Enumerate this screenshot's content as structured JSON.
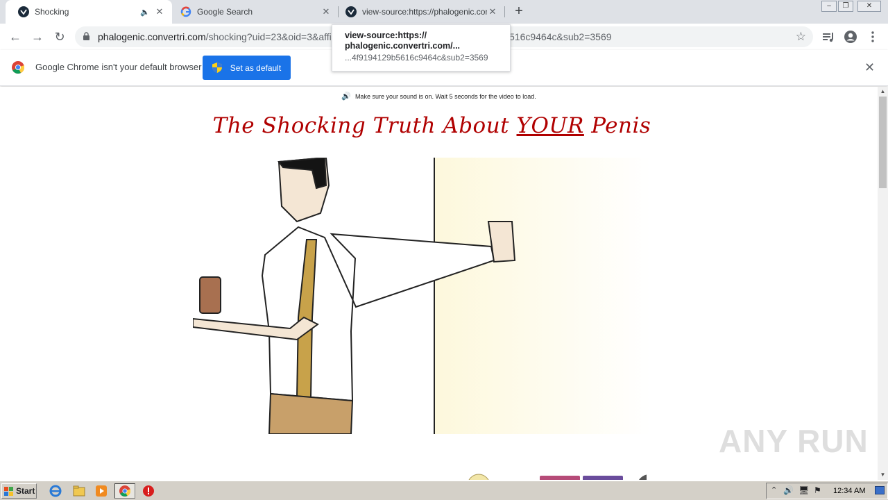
{
  "tabs": [
    {
      "title": "Shocking",
      "favicon": "convertri-icon",
      "audio": true,
      "active": true
    },
    {
      "title": "Google Search",
      "favicon": "google-g-icon",
      "active": false
    },
    {
      "title": "view-source:https://phalogenic.conv",
      "favicon": "convertri-icon",
      "active": false
    }
  ],
  "address_bar": {
    "host": "phalogenic.convertri.com",
    "path": "/shocking?uid=23&oid=3&affi",
    "tail": "516c9464c&sub2=3569"
  },
  "tooltip": {
    "line1": "view-source:https://",
    "line2": "phalogenic.convertri.com/...",
    "line3": "...4f9194129b5616c9464c&sub2=3569"
  },
  "infobar": {
    "message": "Google Chrome isn't your default browser",
    "button_label": "Set as default"
  },
  "page": {
    "sound_note": "Make sure your sound is on. Wait 5 seconds for the video to load.",
    "headline_pre": "The Shocking Truth About ",
    "headline_em": "YOUR",
    "headline_post": " Penis"
  },
  "watermark": "ANY RUN",
  "taskbar": {
    "start_label": "Start",
    "clock": "12:34 AM",
    "apps": [
      "ie-icon",
      "explorer-icon",
      "media-player-icon",
      "chrome-icon",
      "stop-icon"
    ]
  },
  "colors": {
    "headline": "#b00000",
    "accent": "#1a73e8",
    "tabstrip": "#dee1e6"
  }
}
